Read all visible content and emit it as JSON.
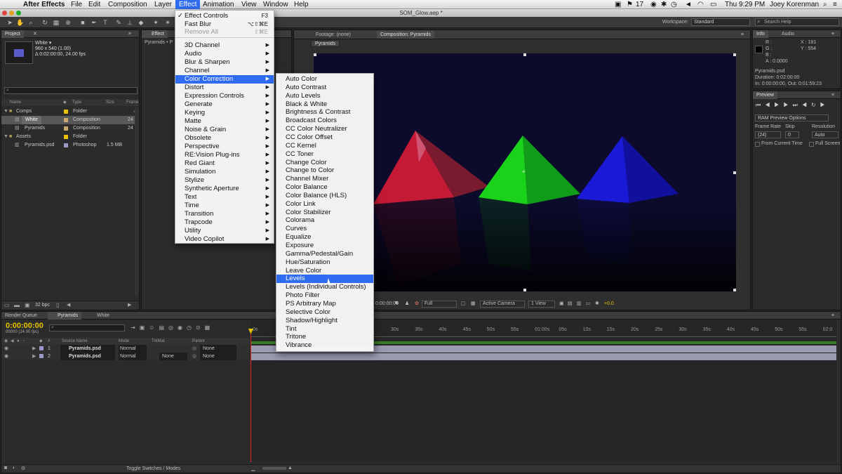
{
  "menubar": {
    "app": "After Effects",
    "items": [
      "File",
      "Edit",
      "Composition",
      "Layer",
      "Effect",
      "Animation",
      "View",
      "Window",
      "Help"
    ],
    "active": "Effect",
    "status": {
      "number": "17",
      "clock": "Thu 9:29 PM",
      "user": "Joey Korenman"
    }
  },
  "window": {
    "title": "SOM_Glow.aep *"
  },
  "workspace": {
    "label": "Workspace:",
    "value": "Standard",
    "search_placeholder": "Search Help"
  },
  "project": {
    "tab": "Project",
    "effects_tab": "Effect",
    "selected": {
      "name": "White ▾",
      "dims": "960 x 540 (1.00)",
      "duration": "Δ 0:02:00:00, 24.00 fps"
    },
    "columns": {
      "name": "Name",
      "type": "Type",
      "size": "Size",
      "frame": "Frame"
    },
    "items": [
      {
        "name": "Comps",
        "type": "Folder",
        "size": "",
        "frame": "",
        "color": "#e8c200"
      },
      {
        "name": "White",
        "type": "Composition",
        "size": "",
        "frame": "24",
        "color": "#c9a870"
      },
      {
        "name": "Pyramids",
        "type": "Composition",
        "size": "",
        "frame": "24",
        "color": "#c9a870"
      },
      {
        "name": "Assets",
        "type": "Folder",
        "size": "",
        "frame": "",
        "color": "#e8c200"
      },
      {
        "name": "Pyramids.psd",
        "type": "Photoshop",
        "size": "1.5 MB",
        "frame": "",
        "color": "#9a9ac8"
      }
    ],
    "bpc": "32 bpc"
  },
  "viewer": {
    "footage_tab": "Footage: (none)",
    "comp_tab": "Composition: Pyramids",
    "comp_button": "Pyramids",
    "timecode": "0:00:00:00",
    "resolution": "Full",
    "camera": "Active Camera",
    "views": "1 View",
    "exposure": "+0.0"
  },
  "info": {
    "tab": "Info",
    "audio_tab": "Audio",
    "r": "R :",
    "g": "G :",
    "b": "B :",
    "a": "A : 0.0000",
    "x": "X : 181",
    "y": "Y : 554",
    "file": "Pyramids.psd",
    "duration": "Duration: 0:02:00:00",
    "inout": "In: 0:00:00:00, Out: 0:01:59:23"
  },
  "preview": {
    "tab": "Preview",
    "ram_options": "RAM Preview Options",
    "frame_rate_label": "Frame Rate",
    "frame_rate": "(24)",
    "skip_label": "Skip",
    "skip": "0",
    "resolution_label": "Resolution",
    "resolution": "Auto",
    "from_current": "From Current Time",
    "full_screen": "Full Screen"
  },
  "effect_menu": {
    "items": [
      {
        "label": "Effect Controls",
        "shortcut": "F3",
        "check": true
      },
      {
        "label": "Fast Blur",
        "shortcut": "⌥⇧⌘E"
      },
      {
        "label": "Remove All",
        "shortcut": "⇧⌘E",
        "disabled": true
      },
      {
        "label": "3D Channel",
        "sub": true
      },
      {
        "label": "Audio",
        "sub": true
      },
      {
        "label": "Blur & Sharpen",
        "sub": true
      },
      {
        "label": "Channel",
        "sub": true
      },
      {
        "label": "Color Correction",
        "sub": true,
        "highlight": true
      },
      {
        "label": "Distort",
        "sub": true
      },
      {
        "label": "Expression Controls",
        "sub": true
      },
      {
        "label": "Generate",
        "sub": true
      },
      {
        "label": "Keying",
        "sub": true
      },
      {
        "label": "Matte",
        "sub": true
      },
      {
        "label": "Noise & Grain",
        "sub": true
      },
      {
        "label": "Obsolete",
        "sub": true
      },
      {
        "label": "Perspective",
        "sub": true
      },
      {
        "label": "RE:Vision Plug-ins",
        "sub": true
      },
      {
        "label": "Red Giant",
        "sub": true
      },
      {
        "label": "Simulation",
        "sub": true
      },
      {
        "label": "Stylize",
        "sub": true
      },
      {
        "label": "Synthetic Aperture",
        "sub": true
      },
      {
        "label": "Text",
        "sub": true
      },
      {
        "label": "Time",
        "sub": true
      },
      {
        "label": "Transition",
        "sub": true
      },
      {
        "label": "Trapcode",
        "sub": true
      },
      {
        "label": "Utility",
        "sub": true
      },
      {
        "label": "Video Copilot",
        "sub": true
      }
    ]
  },
  "color_correction_menu": {
    "items": [
      "Auto Color",
      "Auto Contrast",
      "Auto Levels",
      "Black & White",
      "Brightness & Contrast",
      "Broadcast Colors",
      "CC Color Neutralizer",
      "CC Color Offset",
      "CC Kernel",
      "CC Toner",
      "Change Color",
      "Change to Color",
      "Channel Mixer",
      "Color Balance",
      "Color Balance (HLS)",
      "Color Link",
      "Color Stabilizer",
      "Colorama",
      "Curves",
      "Equalize",
      "Exposure",
      "Gamma/Pedestal/Gain",
      "Hue/Saturation",
      "Leave Color",
      "Levels",
      "Levels (Individual Controls)",
      "Photo Filter",
      "PS Arbitrary Map",
      "Selective Color",
      "Shadow/Highlight",
      "Tint",
      "Tritone",
      "Vibrance"
    ],
    "highlighted": "Levels"
  },
  "timeline": {
    "tabs": [
      "Render Queue",
      "Pyramids",
      "White"
    ],
    "timecode": "0:00:00:00",
    "fps": "00000 (24.00 fps)",
    "columns": {
      "source": "Source Name",
      "mode": "Mode",
      "trkmat": "TrkMat",
      "parent": "Parent"
    },
    "layers": [
      {
        "num": "1",
        "name": "Pyramids.psd",
        "mode": "Normal",
        "trkmat": "",
        "parent": "None"
      },
      {
        "num": "2",
        "name": "Pyramids.psd",
        "mode": "Normal",
        "trkmat": "None",
        "parent": "None"
      }
    ],
    "ruler": [
      "0s",
      "30s",
      "35s",
      "40s",
      "45s",
      "50s",
      "55s",
      "01:00s",
      "05s",
      "10s",
      "15s",
      "20s",
      "25s",
      "30s",
      "35s",
      "40s",
      "45s",
      "50s",
      "55s",
      "02:0"
    ],
    "toggle": "Toggle Switches / Modes"
  }
}
